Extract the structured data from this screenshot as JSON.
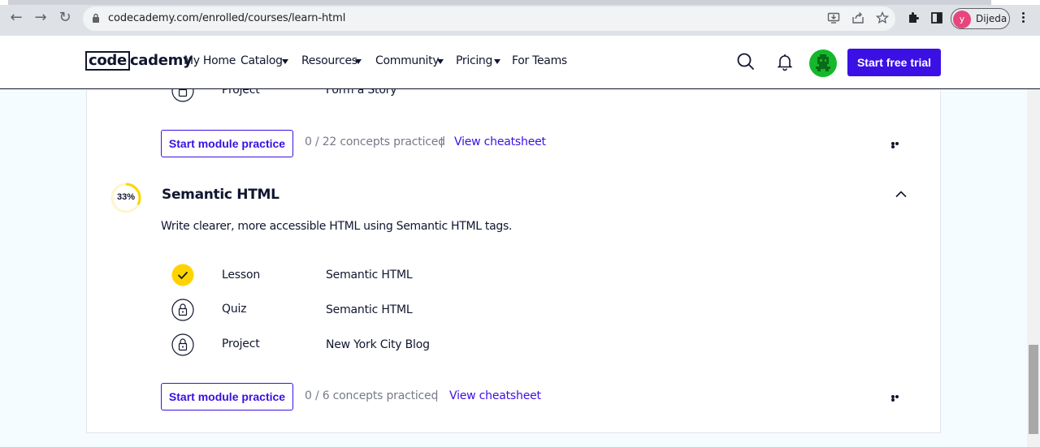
{
  "browser": {
    "url": "codecademy.com/enrolled/courses/learn-html",
    "profile_initial": "y",
    "profile_name": "Dijeda"
  },
  "header": {
    "logo_code": "code",
    "logo_academy": "cademy",
    "nav": [
      {
        "label": "My Home"
      },
      {
        "label": "Catalog"
      },
      {
        "label": "Resources"
      },
      {
        "label": "Community"
      },
      {
        "label": "Pricing"
      },
      {
        "label": "For Teams"
      }
    ],
    "trial_label": "Start free trial",
    "accent_color": "#3a10e5"
  },
  "prev_module": {
    "partial_row": {
      "type": "Project",
      "title": "Form a Story",
      "icon": "lock-icon"
    },
    "practice_label": "Start module practice",
    "concepts": "0 / 22 concepts practiced",
    "cheatsheet_label": "View cheatsheet"
  },
  "module": {
    "progress_text": "33%",
    "progress_fraction": 0.33,
    "title": "Semantic HTML",
    "description": "Write clearer, more accessible HTML using Semantic HTML tags.",
    "rows": [
      {
        "type": "Lesson",
        "title": "Semantic HTML",
        "icon": "check-icon",
        "done": true
      },
      {
        "type": "Quiz",
        "title": "Semantic HTML",
        "icon": "lock-icon",
        "done": false
      },
      {
        "type": "Project",
        "title": "New York City Blog",
        "icon": "lock-icon",
        "done": false
      }
    ],
    "practice_label": "Start module practice",
    "concepts": "0 / 6 concepts practiced",
    "cheatsheet_label": "View cheatsheet"
  }
}
